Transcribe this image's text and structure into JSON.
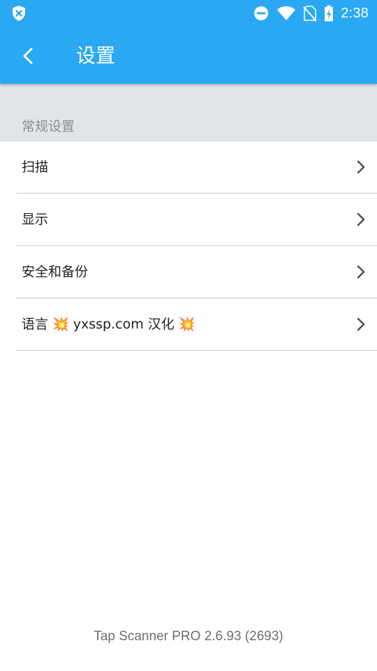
{
  "status_bar": {
    "left_icon": "shield-x-icon",
    "icons": [
      "do-not-disturb-icon",
      "wifi-icon",
      "no-sim-icon",
      "battery-charging-icon"
    ],
    "time": "2:38"
  },
  "app_bar": {
    "back_icon": "chevron-left-icon",
    "title": "设置",
    "color": "#2aa9f2"
  },
  "section": {
    "title": "常规设置"
  },
  "settings": {
    "items": [
      {
        "label": "扫描"
      },
      {
        "label": "显示"
      },
      {
        "label": "安全和备份"
      },
      {
        "label": "语言 💥 yxssp.com 汉化 💥"
      }
    ]
  },
  "footer": {
    "version": "Tap Scanner PRO 2.6.93 (2693)"
  }
}
